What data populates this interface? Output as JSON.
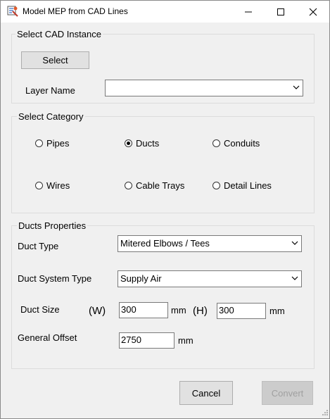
{
  "window": {
    "title": "Model MEP from CAD Lines"
  },
  "cad": {
    "group_title": "Select CAD Instance",
    "select_label": "Select",
    "layer_label": "Layer Name",
    "layer_value": ""
  },
  "category": {
    "group_title": "Select Category",
    "options": [
      "Pipes",
      "Ducts",
      "Conduits",
      "Wires",
      "Cable Trays",
      "Detail Lines"
    ],
    "selected": "Ducts"
  },
  "props": {
    "group_title": "Ducts Properties",
    "duct_type_label": "Duct Type",
    "duct_type_value": "Mitered Elbows / Tees",
    "system_type_label": "Duct System Type",
    "system_type_value": "Supply Air",
    "size_label": "Duct Size",
    "w_label": "(W)",
    "w_value": "300",
    "w_unit": "mm",
    "h_label": "(H)",
    "h_value": "300",
    "h_unit": "mm",
    "offset_label": "General Offset",
    "offset_value": "2750",
    "offset_unit": "mm"
  },
  "actions": {
    "cancel_label": "Cancel",
    "convert_label": "Convert"
  }
}
